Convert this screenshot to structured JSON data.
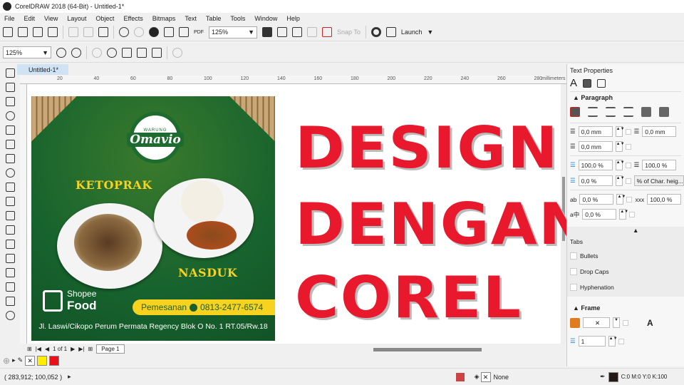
{
  "window": {
    "title": "CorelDRAW 2018 (64-Bit) - Untitled-1*"
  },
  "menu": [
    "File",
    "Edit",
    "View",
    "Layout",
    "Object",
    "Effects",
    "Bitmaps",
    "Text",
    "Table",
    "Tools",
    "Window",
    "Help"
  ],
  "toolbar": {
    "zoom": "125%",
    "snap": "Snap To",
    "launch": "Launch",
    "pdf": "PDF"
  },
  "toolbar2": {
    "zoom": "125%"
  },
  "document": {
    "tab": "Untitled-1*"
  },
  "ruler": {
    "ticks": [
      "20",
      "40",
      "60",
      "80",
      "100",
      "120",
      "140",
      "160",
      "180",
      "200",
      "220",
      "240",
      "260",
      "280"
    ],
    "unit": "millimeters"
  },
  "poster": {
    "brand_small": "WARUNG",
    "brand": "Omavio",
    "dish1": "KETOPRAK",
    "dish2": "NASDUK",
    "shopee1": "Shopee",
    "shopee2": "Food",
    "order_label": "Pemesanan",
    "phone": "0813-2477-6574",
    "address": "Jl. Laswi/Cikopo Perum Permata Regency Blok O No. 1 RT.05/Rw.18"
  },
  "headline": [
    "DESIGN",
    "DENGAN",
    "COREL"
  ],
  "pages": {
    "counter": "1 of 1",
    "tab": "Page 1"
  },
  "palette": {
    "colors": [
      "#ffee00",
      "#e8101a"
    ]
  },
  "status": {
    "coords": "( 283,912; 100,052 )",
    "fill": "None",
    "outline": "C:0 M:0 Y:0 K:100"
  },
  "panel": {
    "title": "Text Properties",
    "paragraph": "Paragraph",
    "indent_first": "0,0 mm",
    "indent_left": "0,0 mm",
    "indent_right": "0,0 mm",
    "line_spacing": "100,0 %",
    "para_before": "100,0 %",
    "para_after": "0,0 %",
    "spacing_unit": "% of Char. heig...",
    "char_spacing": "0,0 %",
    "word_spacing": "100,0 %",
    "lang_spacing": "0,0 %",
    "tabs": "Tabs",
    "bullets": "Bullets",
    "dropcaps": "Drop Caps",
    "hyphenation": "Hyphenation",
    "frame": "Frame",
    "columns": "1"
  }
}
